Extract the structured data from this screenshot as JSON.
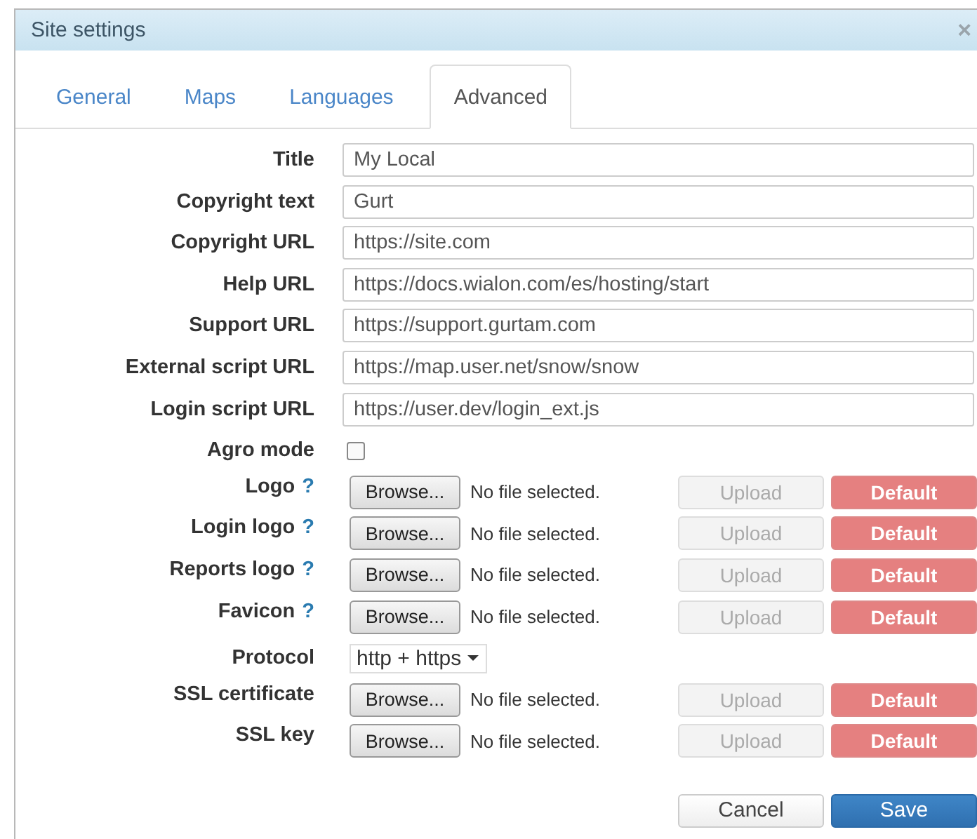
{
  "window": {
    "title": "Site settings",
    "close": "×"
  },
  "tabs": [
    {
      "label": "General",
      "selected": false
    },
    {
      "label": "Maps",
      "selected": false
    },
    {
      "label": "Languages",
      "selected": false
    },
    {
      "label": "Advanced",
      "selected": true
    }
  ],
  "fields": [
    {
      "kind": "text",
      "label": "Title",
      "value": "My Local"
    },
    {
      "kind": "text",
      "label": "Copyright text",
      "value": "Gurt"
    },
    {
      "kind": "text",
      "label": "Copyright URL",
      "value": "https://site.com"
    },
    {
      "kind": "text",
      "label": "Help URL",
      "value": "https://docs.wialon.com/es/hosting/start"
    },
    {
      "kind": "text",
      "label": "Support URL",
      "value": "https://support.gurtam.com"
    },
    {
      "kind": "text",
      "label": "External script URL",
      "value": "https://map.user.net/snow/snow"
    },
    {
      "kind": "text",
      "label": "Login script URL",
      "value": "https://user.dev/login_ext.js"
    },
    {
      "kind": "checkbox",
      "label": "Agro mode",
      "checked": false
    },
    {
      "kind": "file",
      "label": "Logo",
      "help": "?",
      "browse": "Browse...",
      "status": "No file selected.",
      "upload": "Upload",
      "upload_disabled": true,
      "default": "Default"
    },
    {
      "kind": "file",
      "label": "Login logo",
      "help": "?",
      "browse": "Browse...",
      "status": "No file selected.",
      "upload": "Upload",
      "upload_disabled": true,
      "default": "Default"
    },
    {
      "kind": "file",
      "label": "Reports logo",
      "help": "?",
      "browse": "Browse...",
      "status": "No file selected.",
      "upload": "Upload",
      "upload_disabled": true,
      "default": "Default"
    },
    {
      "kind": "file",
      "label": "Favicon",
      "help": "?",
      "browse": "Browse...",
      "status": "No file selected.",
      "upload": "Upload",
      "upload_disabled": true,
      "default": "Default"
    },
    {
      "kind": "select",
      "label": "Protocol",
      "value": "http + https"
    },
    {
      "kind": "file",
      "label": "SSL certificate",
      "browse": "Browse...",
      "status": "No file selected.",
      "upload": "Upload",
      "upload_disabled": true,
      "default": "Default"
    },
    {
      "kind": "file",
      "label": "SSL key",
      "browse": "Browse...",
      "status": "No file selected.",
      "upload": "Upload",
      "upload_disabled": true,
      "default": "Default"
    }
  ],
  "buttons": {
    "cancel": "Cancel",
    "save": "Save"
  }
}
